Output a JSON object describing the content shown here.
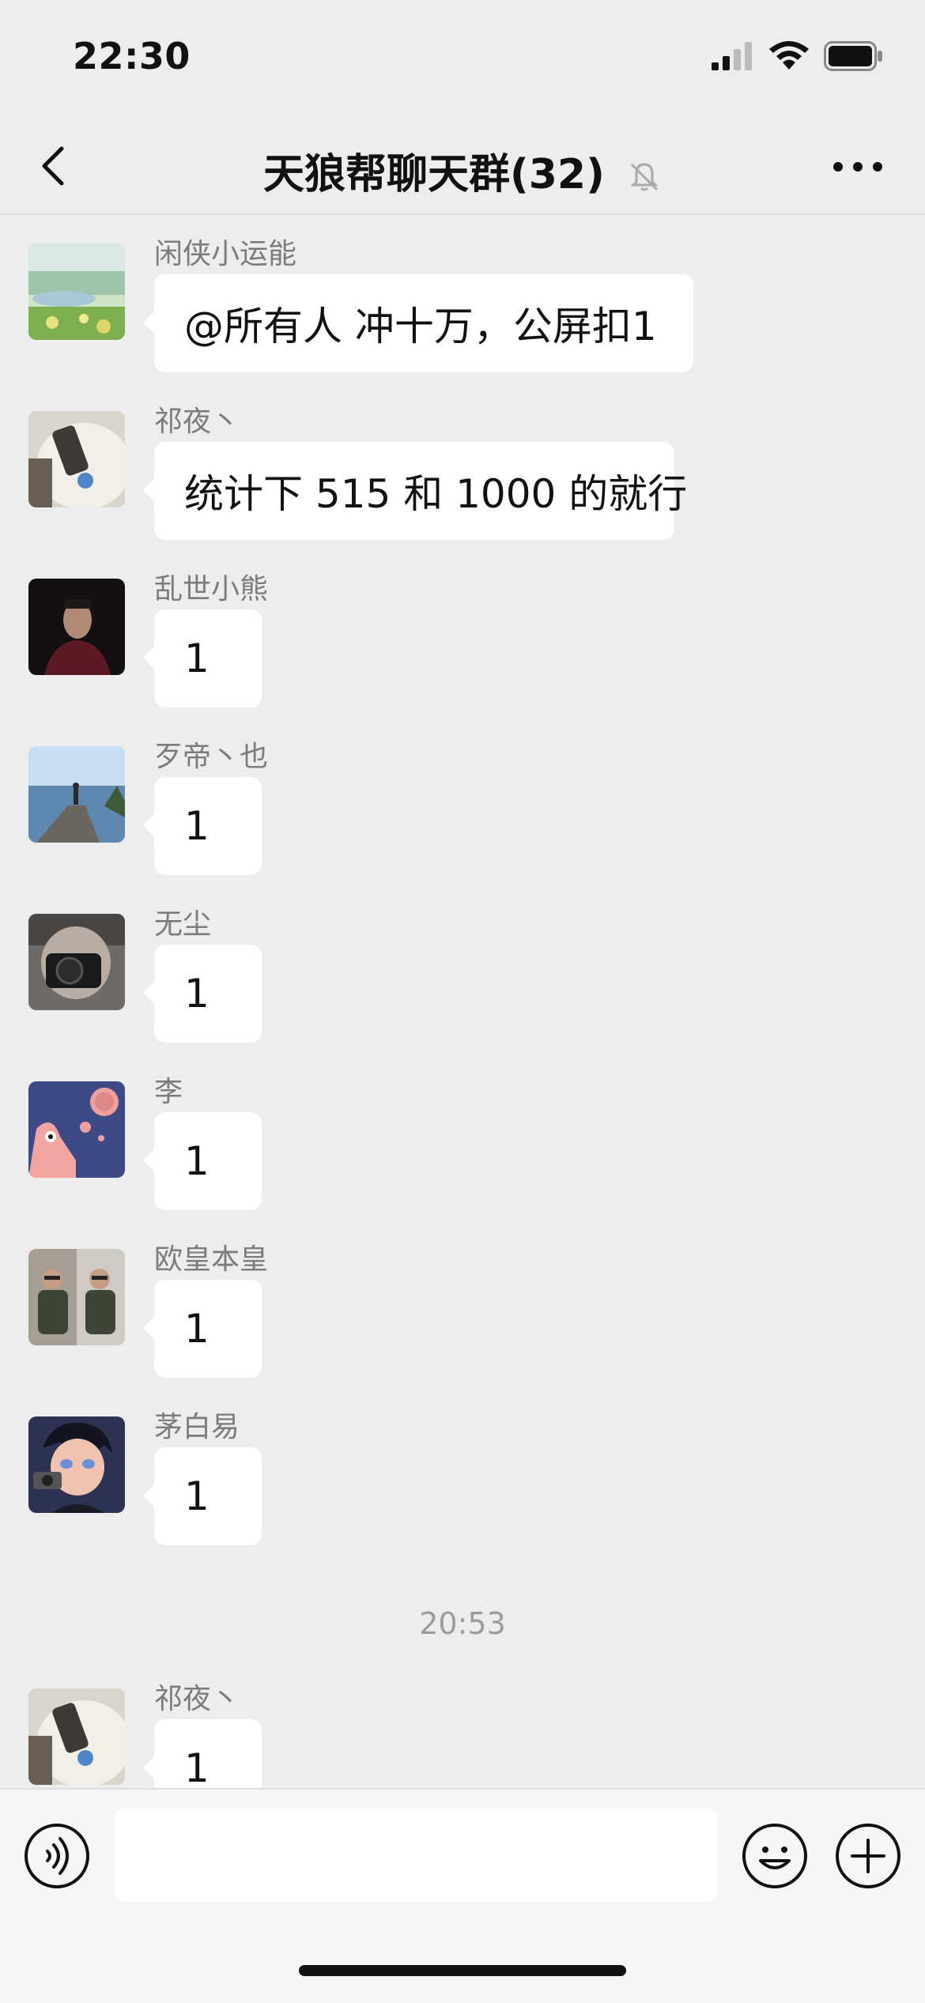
{
  "status_bar": {
    "time": "22:30",
    "icons": [
      "cellular-signal-icon",
      "wifi-icon",
      "battery-icon"
    ]
  },
  "nav": {
    "back_icon": "chevron-left-icon",
    "title": "天狼帮聊天群(32)",
    "mute_icon": "bell-muted-icon",
    "more_icon": "ellipsis-icon"
  },
  "messages": [
    {
      "sender": "闲侠小运能",
      "text": "@所有人 冲十万，公屏扣1",
      "avatar": "landscape-avatar"
    },
    {
      "sender": "祁夜丶",
      "text": "统计下 515 和 1000 的就行",
      "avatar": "figure-avatar"
    },
    {
      "sender": "乱世小熊",
      "text": "1",
      "avatar": "portrait-avatar"
    },
    {
      "sender": "歹帝丶也",
      "text": "1",
      "avatar": "lake-avatar"
    },
    {
      "sender": "无尘",
      "text": "1",
      "avatar": "camera-avatar"
    },
    {
      "sender": "李",
      "text": "1",
      "avatar": "patrick-avatar"
    },
    {
      "sender": "欧皇本皇",
      "text": "1",
      "avatar": "twins-avatar"
    },
    {
      "sender": "茅白易",
      "text": "1",
      "avatar": "anime-avatar"
    }
  ],
  "time_divider": "20:53",
  "last_message": {
    "sender": "祁夜丶",
    "text": "1",
    "avatar": "figure-avatar"
  },
  "input_bar": {
    "voice_icon": "voice-icon",
    "input_value": "",
    "emoji_icon": "emoji-icon",
    "plus_icon": "plus-circle-icon"
  }
}
